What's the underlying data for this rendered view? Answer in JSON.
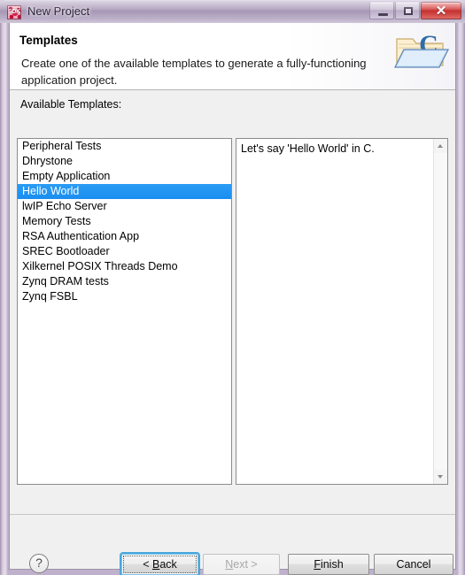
{
  "window": {
    "title": "New Project",
    "app_icon": "sdk-icon",
    "icon_label": "SDK",
    "controls": [
      {
        "name": "minimize",
        "glyph": "minimize-icon"
      },
      {
        "name": "maximize",
        "glyph": "maximize-icon"
      },
      {
        "name": "close",
        "glyph": "close-icon",
        "symbol": "✕"
      }
    ],
    "accent_title_bg": "#ab9cb9",
    "close_button_color": "#c22a2a"
  },
  "header": {
    "title": "Templates",
    "description": "Create one of the available templates to generate a fully-functioning application project.",
    "icon": "folder-c-icon"
  },
  "body": {
    "available_label": "Available Templates:",
    "templates": [
      "Peripheral Tests",
      "Dhrystone",
      "Empty Application",
      "Hello World",
      "lwIP Echo Server",
      "Memory Tests",
      "RSA Authentication App",
      "SREC Bootloader",
      "Xilkernel POSIX Threads Demo",
      "Zynq DRAM tests",
      "Zynq FSBL"
    ],
    "selected_index": 3,
    "selection_color": "#1a8ef0",
    "description_text": "Let's say 'Hello World' in C.",
    "scrollbar": {
      "up_arrow": "scroll-up-icon",
      "down_arrow": "scroll-down-icon"
    }
  },
  "footer": {
    "help": "?",
    "buttons": [
      {
        "id": "back",
        "label": "< Back",
        "mnemonic": "B",
        "state": "focused"
      },
      {
        "id": "next",
        "label": "Next >",
        "mnemonic": "N",
        "state": "disabled"
      },
      {
        "id": "finish",
        "label": "Finish",
        "mnemonic": "F",
        "state": "normal"
      },
      {
        "id": "cancel",
        "label": "Cancel",
        "mnemonic": "",
        "state": "normal"
      }
    ]
  }
}
